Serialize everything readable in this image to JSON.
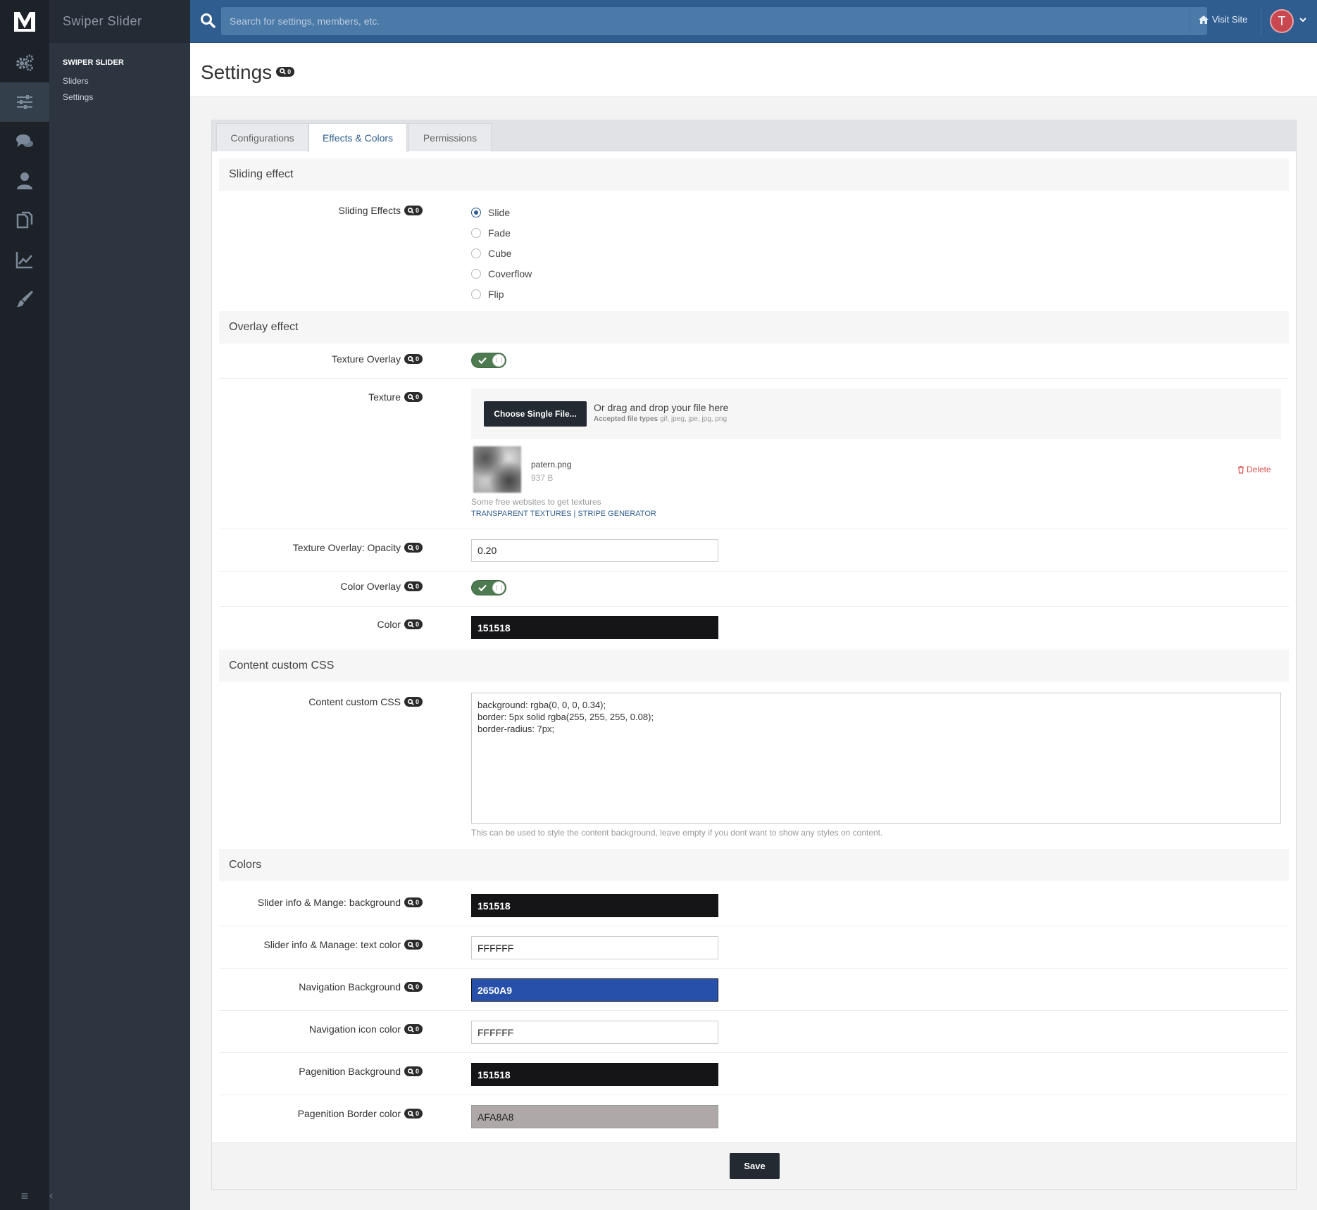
{
  "app": {
    "name": "Swiper Slider"
  },
  "subnav": {
    "section": "SWIPER SLIDER",
    "links": [
      "Sliders",
      "Settings"
    ]
  },
  "topbar": {
    "search_placeholder": "Search for settings, members, etc.",
    "visit_site": "Visit Site",
    "avatar_initial": "T"
  },
  "page": {
    "title": "Settings",
    "badge": "0"
  },
  "tabs": [
    {
      "label": "Configurations",
      "active": false
    },
    {
      "label": "Effects & Colors",
      "active": true
    },
    {
      "label": "Permissions",
      "active": false
    }
  ],
  "sliding": {
    "heading": "Sliding effect",
    "label": "Sliding Effects",
    "options": [
      "Slide",
      "Fade",
      "Cube",
      "Coverflow",
      "Flip"
    ],
    "selected": "Slide"
  },
  "overlay": {
    "heading": "Overlay effect",
    "texture_overlay_label": "Texture Overlay",
    "texture_label": "Texture",
    "choose_button": "Choose Single File...",
    "drag_text": "Or drag and drop your file here",
    "accepted_label": "Accepted file types",
    "accepted_types": "gif, jpeg, jpe, jpg, png",
    "file_name": "patern.png",
    "file_size": "937 B",
    "delete_label": "Delete",
    "help_text": "Some free websites to get textures",
    "help_links": "TRANSPARENT TEXTURES | STRIPE GENERATOR",
    "opacity_label": "Texture Overlay: Opacity",
    "opacity_value": "0.20",
    "color_overlay_label": "Color Overlay",
    "color_label": "Color",
    "color_value": "151518"
  },
  "css": {
    "heading": "Content custom CSS",
    "label": "Content custom CSS",
    "value": "background: rgba(0, 0, 0, 0.34);\nborder: 5px solid rgba(255, 255, 255, 0.08);\nborder-radius: 7px;",
    "help": "This can be used to style the content background, leave empty if you dont want to show any styles on content."
  },
  "colors": {
    "heading": "Colors",
    "fields": [
      {
        "label": "Slider info & Mange: background",
        "value": "151518",
        "bg": "#151518",
        "fg": "#ffffff"
      },
      {
        "label": "Slider info & Manage: text color",
        "value": "FFFFFF",
        "bg": "#ffffff",
        "fg": "#222222"
      },
      {
        "label": "Navigation Background",
        "value": "2650A9",
        "bg": "#2650a9",
        "fg": "#ffffff"
      },
      {
        "label": "Navigation icon color",
        "value": "FFFFFF",
        "bg": "#ffffff",
        "fg": "#222222"
      },
      {
        "label": "Pagenition Background",
        "value": "151518",
        "bg": "#151518",
        "fg": "#ffffff"
      },
      {
        "label": "Pagenition Border color",
        "value": "AFA8A8",
        "bg": "#afa8a8",
        "fg": "#222222"
      }
    ]
  },
  "save_label": "Save"
}
